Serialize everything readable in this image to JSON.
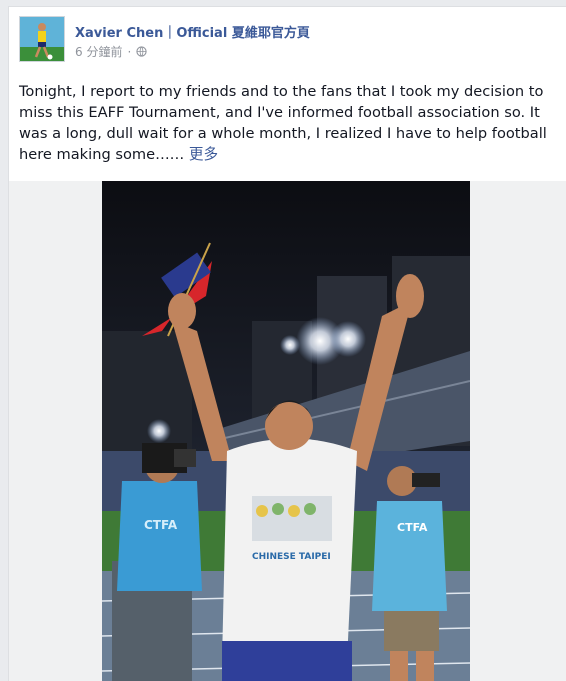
{
  "post": {
    "author": "Xavier Chen｜Official 夏維耶官方頁",
    "time": "6 分鐘前",
    "privacy_icon": "globe-icon",
    "text": "Tonight, I report to my friends and to the fans that I took my decision to miss this EAFF Tournament, and I've informed football association so. It was a long, dull wait for a whole month, I realized I have to help football here making some……",
    "more_label": "更多"
  },
  "photo": {
    "subject": "player-waving",
    "shirt_text": "CHINESE TAIPEI",
    "vest_text": "CTFA"
  },
  "colors": {
    "link": "#3b5998",
    "text": "#141823",
    "muted": "#90949c",
    "flag_red": "#d7262b",
    "flag_blue": "#2a3a8e",
    "vest_blue": "#3a9bd4"
  }
}
